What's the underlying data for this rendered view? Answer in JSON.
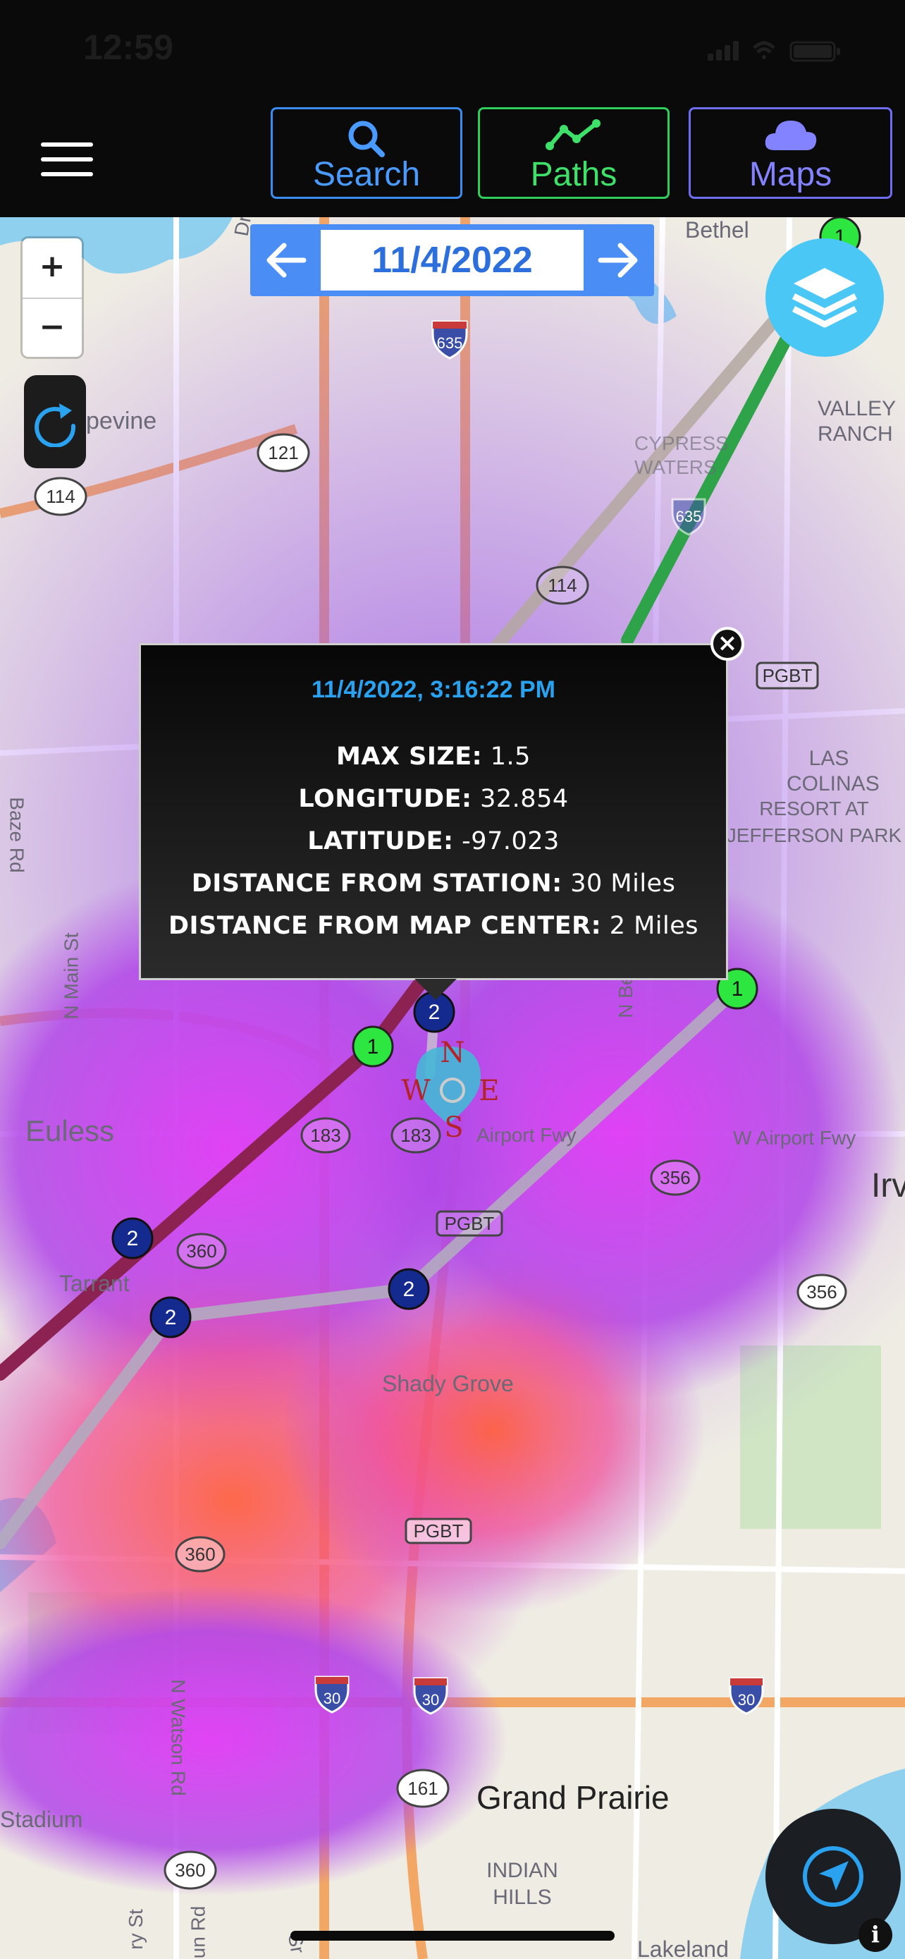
{
  "status_bar": {
    "time": "12:59"
  },
  "toolbar": {
    "search_label": "Search",
    "paths_label": "Paths",
    "maps_label": "Maps",
    "colors": {
      "search": "#3b8cf0",
      "paths": "#2fce5a",
      "maps": "#6f6ef2"
    }
  },
  "map_controls": {
    "zoom_in": "+",
    "zoom_out": "−",
    "date": "11/4/2022",
    "layers_icon": "layers-icon",
    "refresh_icon": "refresh-icon",
    "locate_icon": "navigation-arrow-icon",
    "info": "i"
  },
  "popup": {
    "timestamp": "11/4/2022, 3:16:22 PM",
    "rows": [
      {
        "label": "MAX SIZE:",
        "value": "1.5"
      },
      {
        "label": "LONGITUDE:",
        "value": "32.854"
      },
      {
        "label": "LATITUDE:",
        "value": "-97.023"
      },
      {
        "label": "DISTANCE FROM STATION:",
        "value": "30 Miles"
      },
      {
        "label": "DISTANCE FROM MAP CENTER:",
        "value": "2 Miles"
      }
    ],
    "close": "×"
  },
  "compass": {
    "n": "N",
    "e": "E",
    "s": "S",
    "w": "W"
  },
  "markers": [
    "1",
    "2",
    "2",
    "1",
    "1",
    "2",
    "2",
    "2"
  ],
  "map_labels": {
    "bethel": "Bethel",
    "grapevine": "pevine",
    "valley_ranch": "VALLEY RANCH",
    "cypress_waters": "CYPRESS WATERS",
    "las_colinas": "LAS COLINAS",
    "resort": "RESORT AT JEFFERSON PARK",
    "baze_rd": "Baze Rd",
    "n_main_st": "N Main St",
    "n_belt_line": "N Belt L",
    "euless": "Euless",
    "airport_fwy": "Airport Fwy",
    "w_airport_fwy": "W Airport Fwy",
    "irving": "Irv",
    "tarrant": "Tarrant",
    "shady_grove": "Shady Grove",
    "n_watson_rd": "N Watson Rd",
    "grand_prairie": "Grand Prairie",
    "indian_hills": "INDIAN HILLS",
    "stadium": "Stadium",
    "lakeland": "Lakeland",
    "dr": "Dr",
    "ry_st": "ry St",
    "un_rd": "un Rd",
    "sr": "Sr"
  },
  "shields": [
    "635",
    "121",
    "114",
    "114",
    "635",
    "PGBT",
    "183",
    "183",
    "356",
    "360",
    "PGBT",
    "356",
    "360",
    "PGBT",
    "30",
    "30",
    "30",
    "161",
    "360",
    "161"
  ]
}
